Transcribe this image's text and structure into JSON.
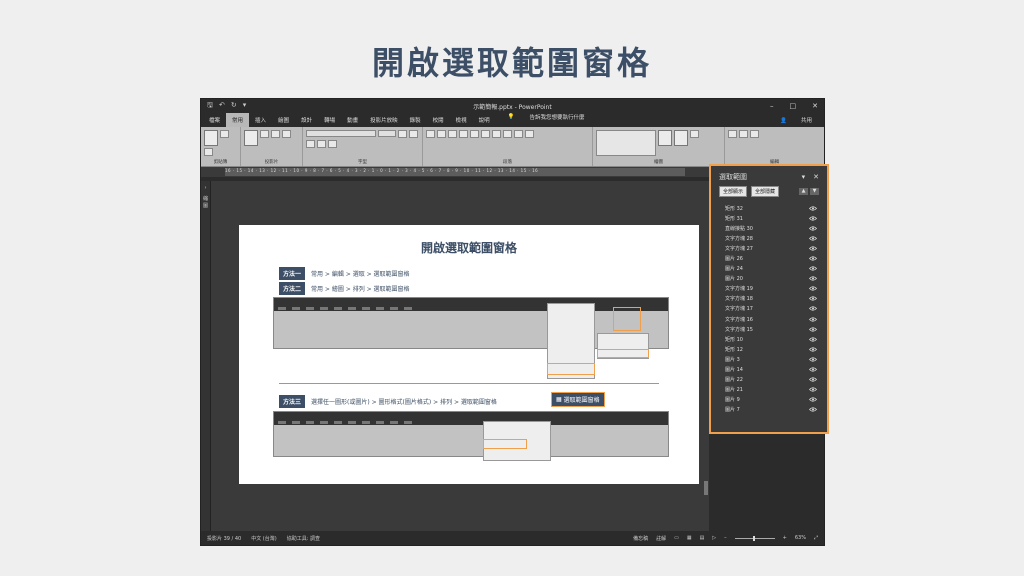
{
  "slide_heading": "開啟選取範圍窗格",
  "app": {
    "window_title": "示範簡報.pptx - PowerPoint",
    "tabs": [
      "檔案",
      "常用",
      "插入",
      "繪圖",
      "設計",
      "轉場",
      "動畫",
      "投影片放映",
      "錄製",
      "校閱",
      "檢視",
      "說明"
    ],
    "tell_me": "告訴我您想要執行什麼",
    "share": "共用",
    "ribbon_groups": [
      "剪貼簿",
      "投影片",
      "字型",
      "段落",
      "繪圖",
      "編輯"
    ],
    "ruler_text": "16 · 15 · 14 · 13 · 12 · 11 · 10 · 9 · 8 · 7 · 6 · 5 · 4 · 3 · 2 · 1 · 0 · 1 · 2 · 3 · 4 · 5 · 6 · 7 · 8 · 9 · 10 · 11 · 12 · 13 · 14 · 15 · 16",
    "thumbs_label": "縮圖",
    "status": {
      "slide_counter": "投影片 39 / 40",
      "language": "中文 (台灣)",
      "accessibility": "協助工具: 調查",
      "notes": "備忘稿",
      "comments": "註解",
      "zoom": "63%"
    }
  },
  "slide": {
    "title": "開啟選取範圍窗格",
    "methods": [
      {
        "badge": "方法一",
        "text": "常用 > 編輯 > 選取 > 選取範圍窗格"
      },
      {
        "badge": "方法二",
        "text": "常用 > 繪圖 > 排列 > 選取範圍窗格"
      },
      {
        "badge": "方法三",
        "text": "選擇任一圖形(或圖片) > 圖形格式(圖片格式) > 排列 > 選取範圍窗格"
      }
    ],
    "highlight_button": "選取範圍窗格"
  },
  "selection_pane": {
    "title": "選取範圍",
    "show_all": "全部顯示",
    "hide_all": "全部隱藏",
    "items": [
      "矩形 32",
      "矩形 31",
      "直線接點 30",
      "文字方塊 28",
      "文字方塊 27",
      "圖片 26",
      "圖片 24",
      "圖片 20",
      "文字方塊 19",
      "文字方塊 18",
      "文字方塊 17",
      "文字方塊 16",
      "文字方塊 15",
      "矩形 10",
      "矩形 12",
      "圖片 3",
      "圖片 14",
      "圖片 22",
      "圖片 21",
      "圖片 9",
      "圖片 7"
    ]
  },
  "colors": {
    "accent": "#f0a04b",
    "navy": "#3d4f66"
  }
}
